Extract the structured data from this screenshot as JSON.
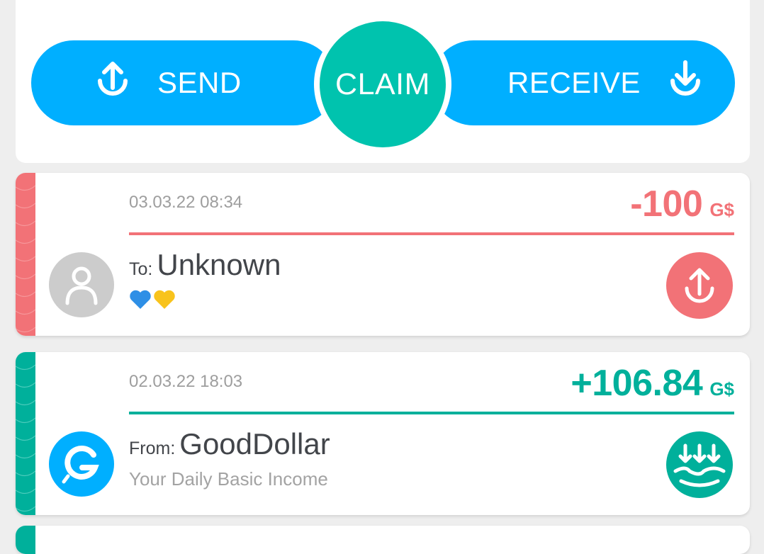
{
  "actions": {
    "send_label": "SEND",
    "claim_label": "CLAIM",
    "receive_label": "RECEIVE"
  },
  "colors": {
    "primary_blue": "#00afff",
    "claim_green": "#00c3ae",
    "sent_red": "#f27277",
    "received_green": "#00b09b"
  },
  "transactions": [
    {
      "type": "sent",
      "date": "03.03.22 08:34",
      "amount": "-100",
      "currency": "G$",
      "prefix": "To:",
      "name": "Unknown",
      "memo_emoji": [
        "blue-heart",
        "yellow-heart"
      ],
      "avatar": "person-icon",
      "action_icon": "send-arrow-icon"
    },
    {
      "type": "received",
      "date": "02.03.22 18:03",
      "amount": "+106.84",
      "currency": "G$",
      "prefix": "From:",
      "name": "GoodDollar",
      "subtitle": "Your Daily Basic Income",
      "avatar": "gooddollar-logo",
      "action_icon": "ubi-claim-icon"
    }
  ]
}
